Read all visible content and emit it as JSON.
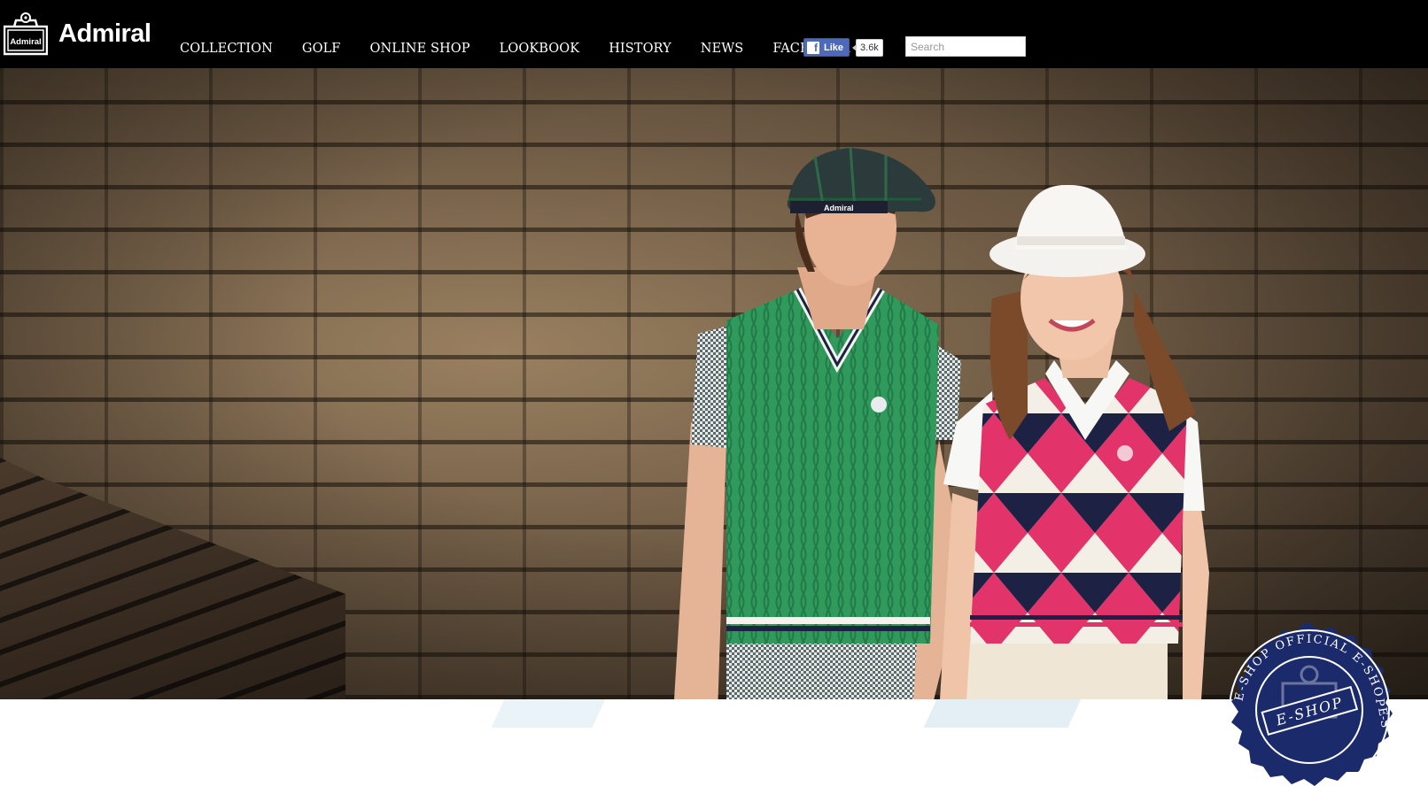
{
  "brand": {
    "name": "Admiral",
    "mark_text": "Admiral"
  },
  "nav": {
    "items": [
      {
        "label": "COLLECTION"
      },
      {
        "label": "GOLF"
      },
      {
        "label": "ONLINE SHOP"
      },
      {
        "label": "LOOKBOOK"
      },
      {
        "label": "HISTORY"
      },
      {
        "label": "NEWS"
      },
      {
        "label": "FACEBOOK"
      }
    ]
  },
  "facebook": {
    "like_label": "Like",
    "like_count": "3.6k"
  },
  "search": {
    "placeholder": "Search",
    "value": ""
  },
  "hero": {
    "cap_logo": "Admiral"
  },
  "badge": {
    "ring_text": "E-SHOP OFFICIAL E-SHOP",
    "ring_text_right": "E-S",
    "ribbon_text": "E-SHOP"
  },
  "colors": {
    "header_bg": "#000000",
    "fb_blue": "#4c69ba",
    "badge_navy": "#1b2a6b",
    "vest_green": "#2f9a5c",
    "argyle_pink": "#e2336b",
    "argyle_navy": "#1d2244"
  },
  "icons": {
    "logo": "admiral-logo-icon",
    "facebook": "facebook-f-icon"
  }
}
